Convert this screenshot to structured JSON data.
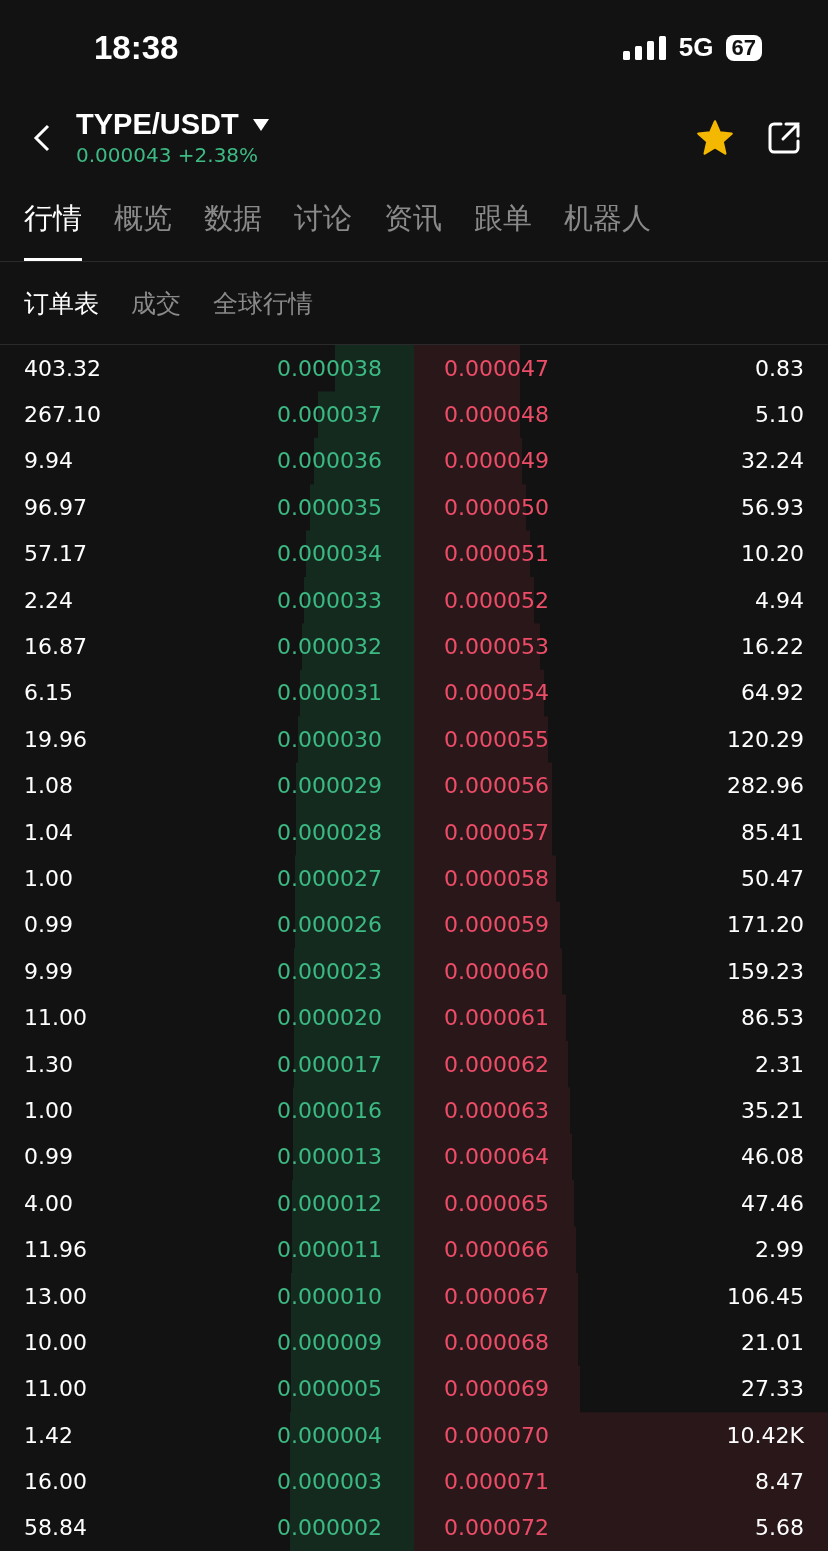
{
  "status_bar": {
    "time": "18:38",
    "network": "5G",
    "battery": "67"
  },
  "header": {
    "pair": "TYPE/USDT",
    "price": "0.000043",
    "change": "+2.38%",
    "favorite": true
  },
  "tabs": [
    {
      "label": "行情",
      "selected": true
    },
    {
      "label": "概览",
      "selected": false
    },
    {
      "label": "数据",
      "selected": false
    },
    {
      "label": "讨论",
      "selected": false
    },
    {
      "label": "资讯",
      "selected": false
    },
    {
      "label": "跟单",
      "selected": false
    },
    {
      "label": "机器人",
      "selected": false
    }
  ],
  "sub_tabs": [
    {
      "label": "订单表",
      "selected": true
    },
    {
      "label": "成交",
      "selected": false
    },
    {
      "label": "全球行情",
      "selected": false
    }
  ],
  "order_book": [
    {
      "bid_qty": "403.32",
      "bid": "0.000038",
      "ask": "0.000047",
      "ask_qty": "0.83"
    },
    {
      "bid_qty": "267.10",
      "bid": "0.000037",
      "ask": "0.000048",
      "ask_qty": "5.10"
    },
    {
      "bid_qty": "9.94",
      "bid": "0.000036",
      "ask": "0.000049",
      "ask_qty": "32.24"
    },
    {
      "bid_qty": "96.97",
      "bid": "0.000035",
      "ask": "0.000050",
      "ask_qty": "56.93"
    },
    {
      "bid_qty": "57.17",
      "bid": "0.000034",
      "ask": "0.000051",
      "ask_qty": "10.20"
    },
    {
      "bid_qty": "2.24",
      "bid": "0.000033",
      "ask": "0.000052",
      "ask_qty": "4.94"
    },
    {
      "bid_qty": "16.87",
      "bid": "0.000032",
      "ask": "0.000053",
      "ask_qty": "16.22"
    },
    {
      "bid_qty": "6.15",
      "bid": "0.000031",
      "ask": "0.000054",
      "ask_qty": "64.92"
    },
    {
      "bid_qty": "19.96",
      "bid": "0.000030",
      "ask": "0.000055",
      "ask_qty": "120.29"
    },
    {
      "bid_qty": "1.08",
      "bid": "0.000029",
      "ask": "0.000056",
      "ask_qty": "282.96"
    },
    {
      "bid_qty": "1.04",
      "bid": "0.000028",
      "ask": "0.000057",
      "ask_qty": "85.41"
    },
    {
      "bid_qty": "1.00",
      "bid": "0.000027",
      "ask": "0.000058",
      "ask_qty": "50.47"
    },
    {
      "bid_qty": "0.99",
      "bid": "0.000026",
      "ask": "0.000059",
      "ask_qty": "171.20"
    },
    {
      "bid_qty": "9.99",
      "bid": "0.000023",
      "ask": "0.000060",
      "ask_qty": "159.23"
    },
    {
      "bid_qty": "11.00",
      "bid": "0.000020",
      "ask": "0.000061",
      "ask_qty": "86.53"
    },
    {
      "bid_qty": "1.30",
      "bid": "0.000017",
      "ask": "0.000062",
      "ask_qty": "2.31"
    },
    {
      "bid_qty": "1.00",
      "bid": "0.000016",
      "ask": "0.000063",
      "ask_qty": "35.21"
    },
    {
      "bid_qty": "0.99",
      "bid": "0.000013",
      "ask": "0.000064",
      "ask_qty": "46.08"
    },
    {
      "bid_qty": "4.00",
      "bid": "0.000012",
      "ask": "0.000065",
      "ask_qty": "47.46"
    },
    {
      "bid_qty": "11.96",
      "bid": "0.000011",
      "ask": "0.000066",
      "ask_qty": "2.99"
    },
    {
      "bid_qty": "13.00",
      "bid": "0.000010",
      "ask": "0.000067",
      "ask_qty": "106.45"
    },
    {
      "bid_qty": "10.00",
      "bid": "0.000009",
      "ask": "0.000068",
      "ask_qty": "21.01"
    },
    {
      "bid_qty": "11.00",
      "bid": "0.000005",
      "ask": "0.000069",
      "ask_qty": "27.33"
    },
    {
      "bid_qty": "1.42",
      "bid": "0.000004",
      "ask": "0.000070",
      "ask_qty": "10.42K"
    },
    {
      "bid_qty": "16.00",
      "bid": "0.000003",
      "ask": "0.000071",
      "ask_qty": "8.47"
    },
    {
      "bid_qty": "58.84",
      "bid": "0.000002",
      "ask": "0.000072",
      "ask_qty": "5.68"
    }
  ]
}
